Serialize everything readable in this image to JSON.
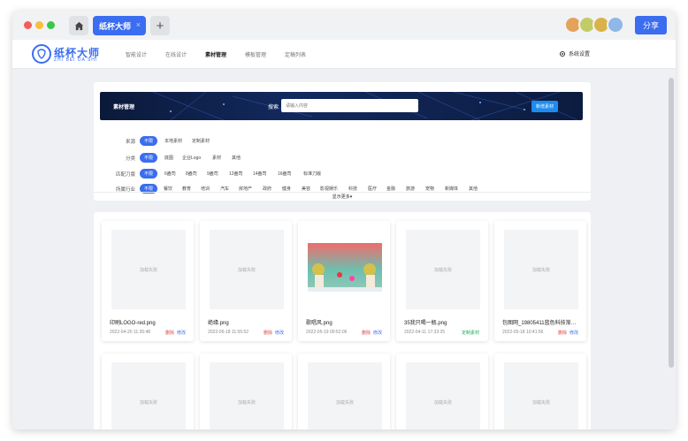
{
  "tabs": {
    "active": "纸杯大师",
    "close": "×",
    "add": "+"
  },
  "share_label": "分享",
  "logo": {
    "cn": "纸杯大师",
    "en": "ZHI BEI DA SHI"
  },
  "nav": [
    "智能设计",
    "在线设计",
    "素材管理",
    "模板管理",
    "定稿列表"
  ],
  "nav_active": "素材管理",
  "settings_label": "系统设置",
  "banner": {
    "title": "素材管理",
    "search_label": "搜索",
    "search_placeholder": "请输入内容",
    "new_button": "新增素材"
  },
  "filters": [
    {
      "label": "来源",
      "options": [
        "不限",
        "本地素材",
        "定制素材"
      ]
    },
    {
      "label": "分类",
      "options": [
        "不限",
        "底图",
        "企业Logo",
        "素材",
        "其他"
      ]
    },
    {
      "label": "匹配刀版",
      "options": [
        "不限",
        "6盎司",
        "8盎司",
        "9盎司",
        "12盎司",
        "14盎司",
        "16盎司",
        "标准刀版"
      ]
    },
    {
      "label": "所属行业",
      "options": [
        "不限",
        "餐饮",
        "教育",
        "培训",
        "汽车",
        "房地产",
        "政府",
        "健身",
        "美容",
        "影视娱乐",
        "科技",
        "医疗",
        "金融",
        "旅游",
        "宠物",
        "新媒体",
        "其他"
      ]
    }
  ],
  "show_more": "显示更多▾",
  "placeholder_text": "加载失败",
  "cards": [
    {
      "name": "印刷LOGO-red.png",
      "date": "2022-04-20 11:35:48",
      "actions": [
        "删除",
        "修改"
      ],
      "image": "placeholder"
    },
    {
      "name": "绝缘.png",
      "date": "2022-05-18 11:55:52",
      "actions": [
        "删除",
        "修改"
      ],
      "image": "placeholder"
    },
    {
      "name": "歌唱风.png",
      "date": "2022-05-19 09:52:06",
      "actions": [
        "删除",
        "修改"
      ],
      "image": "artwork"
    },
    {
      "name": "35我只喝一瓶.png",
      "date": "2022-04-11 17:33:25",
      "actions": [
        "定制素材"
      ],
      "image": "placeholder"
    },
    {
      "name": "包图网_19805411蓝色科技渐变...",
      "date": "2022-05-18 10:41:56",
      "actions": [
        "删除",
        "修改"
      ],
      "image": "placeholder"
    }
  ],
  "colors": {
    "accent": "#3a6df0",
    "delete": "#e54545",
    "custom": "#22a35a"
  }
}
